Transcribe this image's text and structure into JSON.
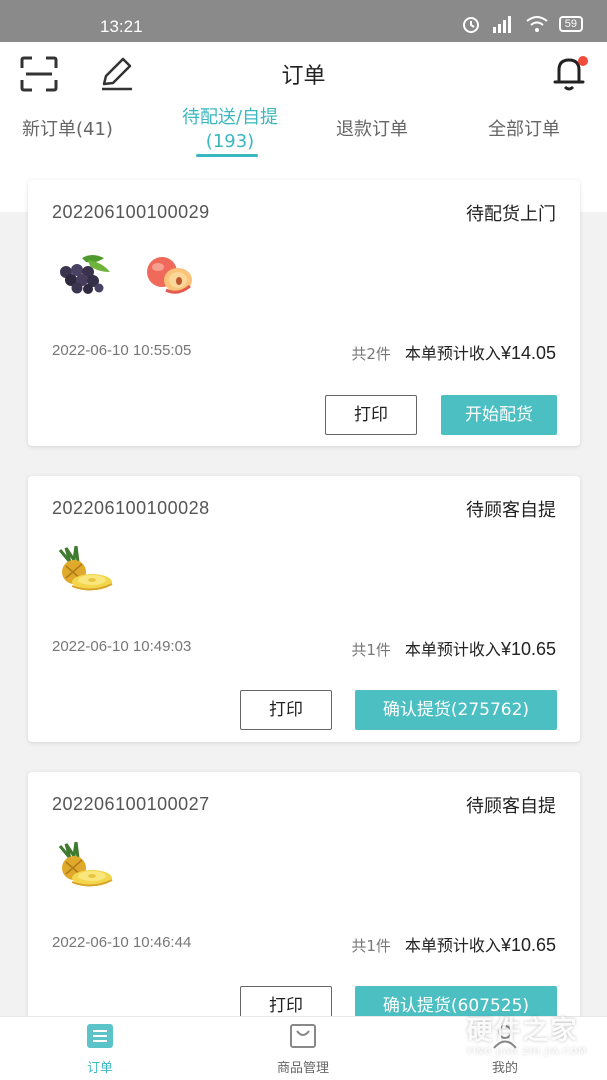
{
  "status_bar": {
    "time": "13:21",
    "battery": "59"
  },
  "header": {
    "title": "订单"
  },
  "tabs": [
    {
      "label": "新订单(41)"
    },
    {
      "label": "待配送/自提",
      "count": "(193)"
    },
    {
      "label": "退款订单"
    },
    {
      "label": "全部订单"
    }
  ],
  "orders": [
    {
      "order_no": "202206100100029",
      "status": "待配货上门",
      "products": [
        "grapes",
        "peach"
      ],
      "time": "2022-06-10 10:55:05",
      "count": "共2件",
      "income_label": "本单预计收入",
      "amount": "¥14.05",
      "print_label": "打印",
      "action_label": "开始配货"
    },
    {
      "order_no": "202206100100028",
      "status": "待顾客自提",
      "products": [
        "pineapple"
      ],
      "time": "2022-06-10 10:49:03",
      "count": "共1件",
      "income_label": "本单预计收入",
      "amount": "¥10.65",
      "print_label": "打印",
      "action_label": "确认提货(275762)"
    },
    {
      "order_no": "202206100100027",
      "status": "待顾客自提",
      "products": [
        "pineapple"
      ],
      "time": "2022-06-10 10:46:44",
      "count": "共1件",
      "income_label": "本单预计收入",
      "amount": "¥10.65",
      "print_label": "打印",
      "action_label": "确认提货(607525)"
    }
  ],
  "bottom_nav": [
    {
      "label": "订单",
      "icon": "orders-icon"
    },
    {
      "label": "商品管理",
      "icon": "bag-icon"
    },
    {
      "label": "我的",
      "icon": "profile-icon"
    }
  ],
  "watermark": {
    "main": "硬件之家",
    "sub": "YING JIAN ZHI JIA.COM"
  },
  "colors": {
    "accent": "#3bb7c0",
    "button": "#4cbfc3",
    "badge": "#f14b3a"
  }
}
